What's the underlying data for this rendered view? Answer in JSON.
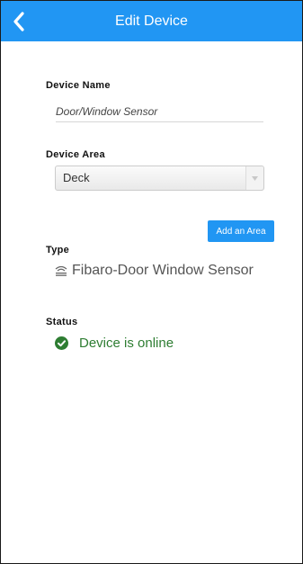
{
  "header": {
    "title": "Edit Device",
    "back_icon": "chevron-left-icon"
  },
  "form": {
    "device_name": {
      "label": "Device Name",
      "value": "Door/Window Sensor"
    },
    "device_area": {
      "label": "Device Area",
      "selected": "Deck"
    },
    "add_area_label": "Add an Area",
    "type": {
      "label": "Type",
      "icon": "wireless-sensor-icon",
      "value": "Fibaro-Door Window Sensor"
    },
    "status": {
      "label": "Status",
      "icon": "check-circle-icon",
      "value": "Device is online"
    }
  },
  "colors": {
    "accent": "#2196f3",
    "online": "#2e7d32"
  }
}
